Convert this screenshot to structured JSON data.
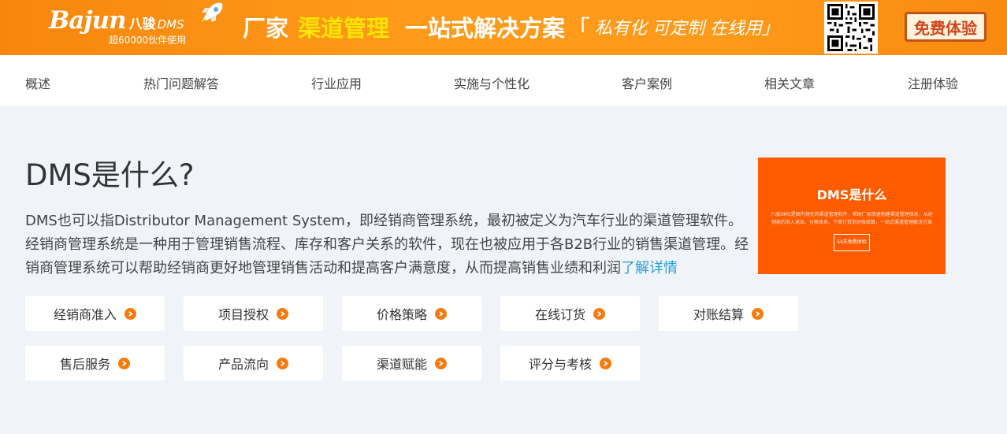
{
  "banner": {
    "logo_brand": "Bajun",
    "logo_cn": "八骏",
    "logo_dms": "DMS",
    "logo_sub": "超60000伙伴使用",
    "slogan_part1": "厂家",
    "slogan_part2": "渠道管理",
    "slogan_part3": "一站式解决方案",
    "slogan_bracket": "「",
    "slogan_part4": "私有化 可定制 在线用」",
    "free_trial_label": "免费体验",
    "colors": {
      "accent": "#ff9a1a",
      "highlight": "#ffe400"
    }
  },
  "nav": {
    "items": [
      {
        "label": "概述"
      },
      {
        "label": "热门问题解答"
      },
      {
        "label": "行业应用"
      },
      {
        "label": "实施与个性化"
      },
      {
        "label": "客户案例"
      },
      {
        "label": "相关文章"
      },
      {
        "label": "注册体验"
      }
    ]
  },
  "main": {
    "title": "DMS是什么?",
    "description": "DMS也可以指Distributor Management System，即经销商管理系统，最初被定义为汽车行业的渠道管理软件。经销商管理系统是一种用于管理销售流程、库存和客户关系的软件，现在也被应用于各B2B行业的销售渠道管理。经销商管理系统可以帮助经销商更好地管理销售活动和提高客户满意度，从而提高销售业绩和利润",
    "more_link": "了解详情"
  },
  "promo": {
    "title": "DMS是什么",
    "text": "八骏DMS是国内领先的渠道管理软件，帮助厂家快速构建渠道管理体系，从经销商的准入退出、价格体系、下单订货到对账结算，一站式渠道管理解决方案",
    "button_label": "54天免费体验",
    "color": "#ff5b00"
  },
  "features": [
    {
      "label": "经销商准入"
    },
    {
      "label": "项目授权"
    },
    {
      "label": "价格策略"
    },
    {
      "label": "在线订货"
    },
    {
      "label": "对账结算"
    },
    {
      "label": "售后服务"
    },
    {
      "label": "产品流向"
    },
    {
      "label": "渠道赋能"
    },
    {
      "label": "评分与考核"
    }
  ]
}
